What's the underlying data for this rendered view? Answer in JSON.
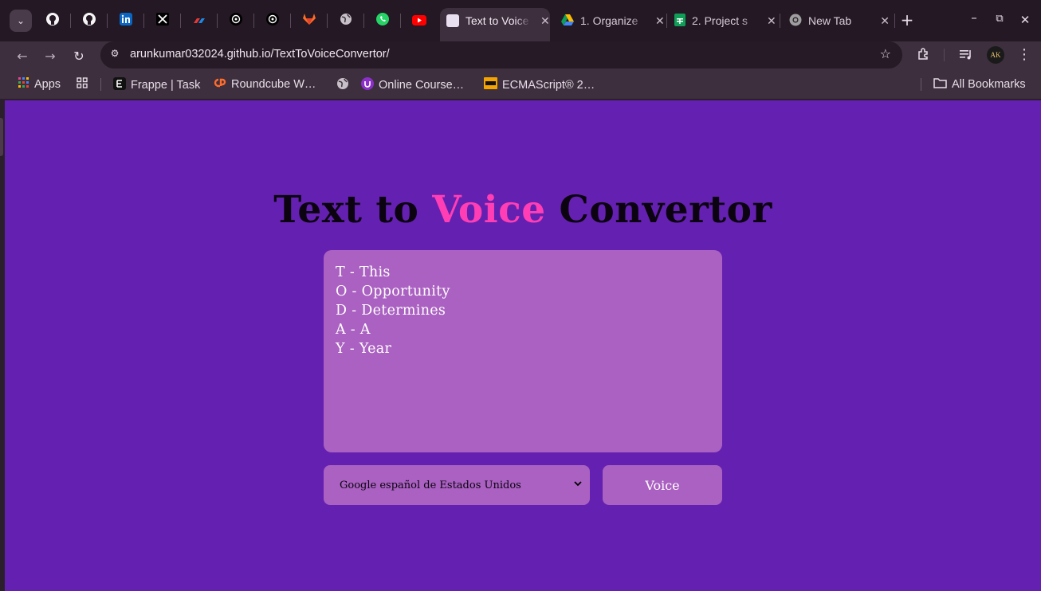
{
  "browser": {
    "tabs": [
      {
        "label": "Text to Voice Convertor",
        "active": true
      },
      {
        "label": "1. Organize"
      },
      {
        "label": "2. Project s"
      },
      {
        "label": "New Tab"
      }
    ],
    "url": "arunkumar032024.github.io/TextToVoiceConvertor/",
    "avatar_initials": "AK",
    "bookmarks": [
      {
        "label": "Apps"
      },
      {
        "label": "Frappe | Task"
      },
      {
        "label": "Roundcube W…"
      },
      {
        "label": "Online Course…"
      },
      {
        "label": "ECMAScript® 2…"
      }
    ],
    "all_bookmarks_label": "All Bookmarks"
  },
  "page": {
    "title_part1": "Text to ",
    "title_highlight": "Voice",
    "title_part3": " Convertor",
    "text_lines": [
      "T - This",
      "O - Opportunity",
      "D - Determines",
      "A - A",
      "Y - Year"
    ],
    "voice_select_value": "Google español de Estados Unidos",
    "voice_button_label": "Voice"
  },
  "colors": {
    "page_background": "#6420b0",
    "panel": "#aa61c1",
    "title_highlight": "#ff3eb5"
  }
}
